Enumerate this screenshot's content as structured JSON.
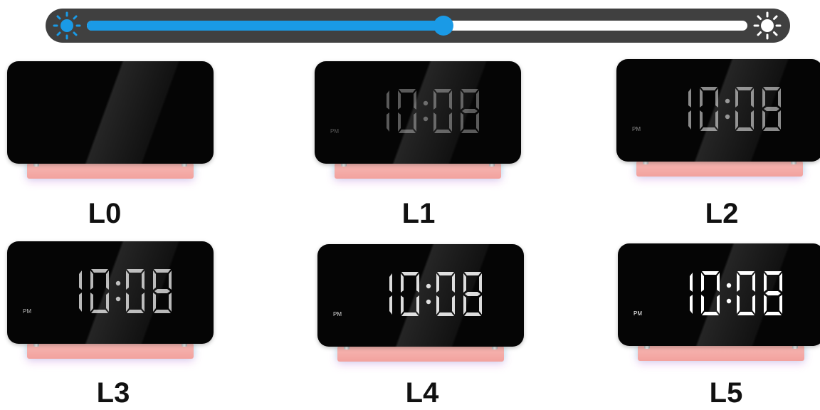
{
  "brightness_slider": {
    "min_icon": "sun-icon",
    "max_icon": "bright-sun-icon",
    "value_percent": 54,
    "track_color": "#404040",
    "fill_color": "#1a9ae6",
    "rail_color": "#ffffff"
  },
  "clock_time": "10:08",
  "clock_period": "PM",
  "levels": [
    {
      "label": "L0",
      "display_on": false,
      "digit_color": "#000000"
    },
    {
      "label": "L1",
      "display_on": true,
      "digit_color": "#5a5a5a"
    },
    {
      "label": "L2",
      "display_on": true,
      "digit_color": "#8a8a8a"
    },
    {
      "label": "L3",
      "display_on": true,
      "digit_color": "#b8b8b8"
    },
    {
      "label": "L4",
      "display_on": true,
      "digit_color": "#dcdcdc"
    },
    {
      "label": "L5",
      "display_on": true,
      "digit_color": "#ffffff"
    }
  ]
}
